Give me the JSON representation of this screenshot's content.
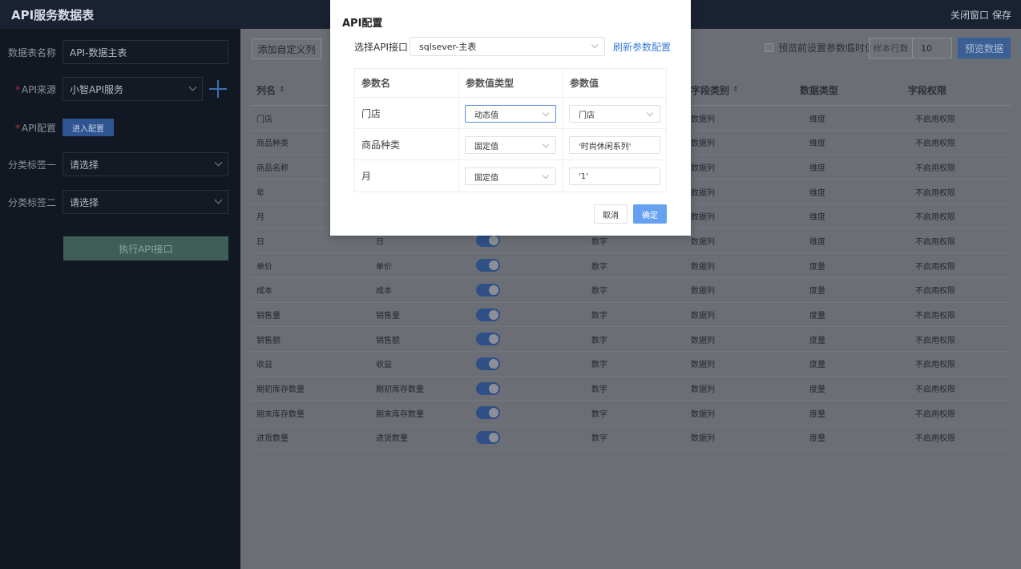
{
  "header": {
    "title": "API服务数据表",
    "close_window": "关闭窗口",
    "save": "保存"
  },
  "sidebar": {
    "table_name_label": "数据表名称",
    "table_name_value": "API-数据主表",
    "api_source_label": "API来源",
    "api_source_value": "小智API服务",
    "api_config_label": "API配置",
    "enter_config": "进入配置",
    "tag1_label": "分类标签一",
    "tag1_value": "请选择",
    "tag2_label": "分类标签二",
    "tag2_value": "请选择",
    "execute": "执行API接口",
    "required_mark": "*"
  },
  "toolbar": {
    "add_custom_column": "添加自定义列",
    "preview_param_label": "预览前设置参数临时值",
    "sample_rows_label": "样本行数",
    "sample_rows_value": "10",
    "preview_data": "预览数据"
  },
  "table": {
    "headers": [
      "列名",
      "字段类别",
      "数据类型",
      "字段权限"
    ],
    "sort_icon": "⇕",
    "rows": [
      {
        "name": "门店",
        "alias": "",
        "type": "",
        "category": "数据列",
        "dtype": "维度",
        "perm": "不启用权限"
      },
      {
        "name": "商品种类",
        "alias": "",
        "type": "",
        "category": "数据列",
        "dtype": "维度",
        "perm": "不启用权限"
      },
      {
        "name": "商品名称",
        "alias": "",
        "type": "",
        "category": "数据列",
        "dtype": "维度",
        "perm": "不启用权限"
      },
      {
        "name": "年",
        "alias": "",
        "type": "",
        "category": "数据列",
        "dtype": "维度",
        "perm": "不启用权限"
      },
      {
        "name": "月",
        "alias": "",
        "type": "",
        "category": "数据列",
        "dtype": "维度",
        "perm": "不启用权限"
      },
      {
        "name": "日",
        "alias": "日",
        "type": "数字",
        "category": "数据列",
        "dtype": "维度",
        "perm": "不启用权限"
      },
      {
        "name": "单价",
        "alias": "单价",
        "type": "数字",
        "category": "数据列",
        "dtype": "度量",
        "perm": "不启用权限"
      },
      {
        "name": "成本",
        "alias": "成本",
        "type": "数字",
        "category": "数据列",
        "dtype": "度量",
        "perm": "不启用权限"
      },
      {
        "name": "销售量",
        "alias": "销售量",
        "type": "数字",
        "category": "数据列",
        "dtype": "度量",
        "perm": "不启用权限"
      },
      {
        "name": "销售额",
        "alias": "销售额",
        "type": "数字",
        "category": "数据列",
        "dtype": "度量",
        "perm": "不启用权限"
      },
      {
        "name": "收益",
        "alias": "收益",
        "type": "数字",
        "category": "数据列",
        "dtype": "度量",
        "perm": "不启用权限"
      },
      {
        "name": "期初库存数量",
        "alias": "期初库存数量",
        "type": "数字",
        "category": "数据列",
        "dtype": "度量",
        "perm": "不启用权限"
      },
      {
        "name": "期末库存数量",
        "alias": "期末库存数量",
        "type": "数字",
        "category": "数据列",
        "dtype": "度量",
        "perm": "不启用权限"
      },
      {
        "name": "进货数量",
        "alias": "进货数量",
        "type": "数字",
        "category": "数据列",
        "dtype": "度量",
        "perm": "不启用权限"
      }
    ]
  },
  "modal": {
    "title": "API配置",
    "select_api_label": "选择API接口",
    "select_api_value": "sqlsever-主表",
    "refresh_params": "刷新参数配置",
    "param_headers": [
      "参数名",
      "参数值类型",
      "参数值"
    ],
    "params": [
      {
        "name": "门店",
        "value_type": "动态值",
        "value": "门店"
      },
      {
        "name": "商品种类",
        "value_type": "固定值",
        "value": "'时尚休闲系列'"
      },
      {
        "name": "月",
        "value_type": "固定值",
        "value": "'1'"
      }
    ],
    "cancel": "取消",
    "confirm": "确定"
  }
}
